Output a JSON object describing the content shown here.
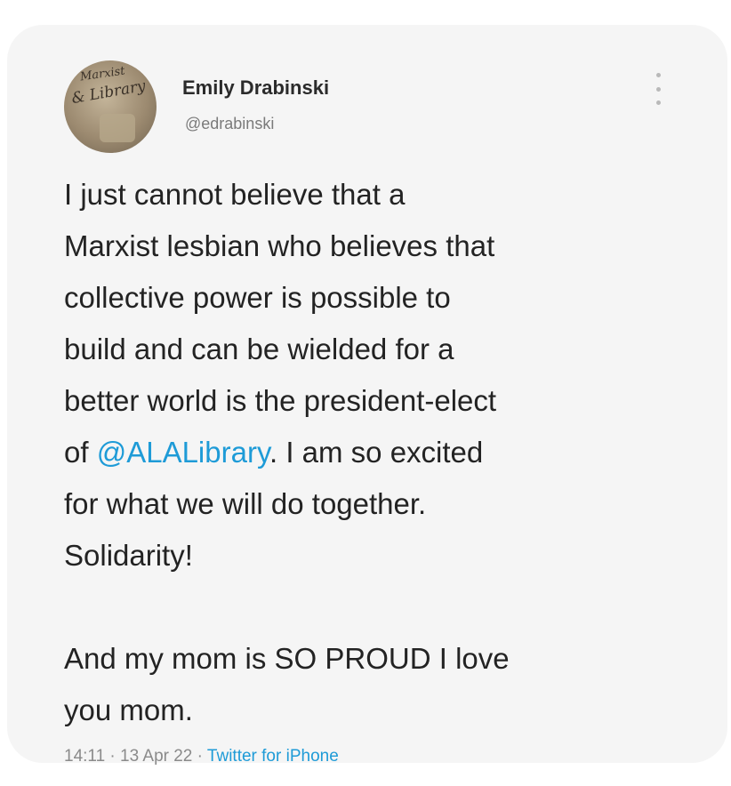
{
  "tweet": {
    "author": {
      "display_name": "Emily Drabinski",
      "handle": "@edrabinski",
      "avatar_text_line1": "Marxist",
      "avatar_text_line2": "& Library"
    },
    "text_lines": [
      "I just cannot believe that a",
      "Marxist lesbian who believes that",
      "collective power is possible to",
      "build and can be wielded for a",
      "better world is the president-elect"
    ],
    "line6_prefix": "of ",
    "mention": "@ALALibrary",
    "line6_suffix": ". I am so excited",
    "text_lines_after": [
      "for what we will do together.",
      "Solidarity!"
    ],
    "text_lines_final": [
      "And my mom is SO PROUD I love",
      "you mom."
    ],
    "time": "14:11",
    "date": "13 Apr 22",
    "separator": "·",
    "source": "Twitter for iPhone",
    "colors": {
      "mention": "#1e9bd7",
      "card_background": "#f5f5f5",
      "text": "#232323"
    },
    "icons": [
      "more-options-icon"
    ]
  }
}
